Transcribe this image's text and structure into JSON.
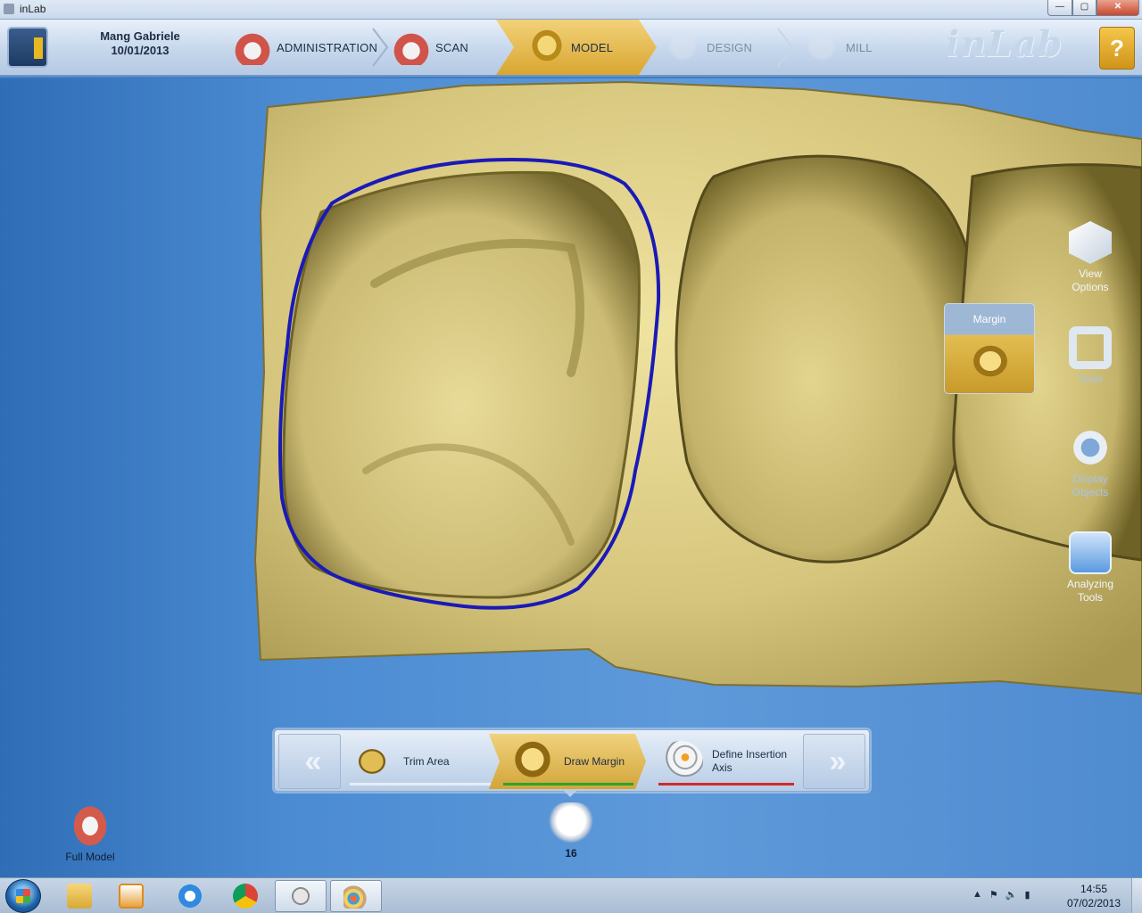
{
  "window": {
    "title": "inLab",
    "min_label": "—",
    "max_label": "▢",
    "close_label": "✕"
  },
  "header": {
    "patient_name": "Mang Gabriele",
    "patient_date": "10/01/2013",
    "steps": [
      {
        "label": "ADMINISTRATION",
        "state": "done"
      },
      {
        "label": "SCAN",
        "state": "done"
      },
      {
        "label": "MODEL",
        "state": "active"
      },
      {
        "label": "DESIGN",
        "state": "disabled"
      },
      {
        "label": "MILL",
        "state": "disabled"
      }
    ],
    "brand": "inLab",
    "help_label": "?"
  },
  "side_tools": {
    "view_options": "View Options",
    "tools": "Tools",
    "display_objects": "Display Objects",
    "analyzing_tools": "Analyzing Tools"
  },
  "margin_panel": {
    "label": "Margin"
  },
  "step_bar": {
    "prev_label": "«",
    "next_label": "»",
    "trim_area": "Trim Area",
    "draw_margin": "Draw Margin",
    "define_insertion_axis": "Define Insertion Axis"
  },
  "bottom": {
    "full_model": "Full Model",
    "tooth_number": "16"
  },
  "taskbar": {
    "time": "14:55",
    "date": "07/02/2013"
  },
  "colors": {
    "accent_gold": "#d9a630",
    "viewport_blue": "#4b8bd2",
    "margin_line": "#1a1ab8",
    "model_surface": "#d9cc82",
    "status_green": "#2aa52a",
    "status_red": "#d12a2a"
  }
}
